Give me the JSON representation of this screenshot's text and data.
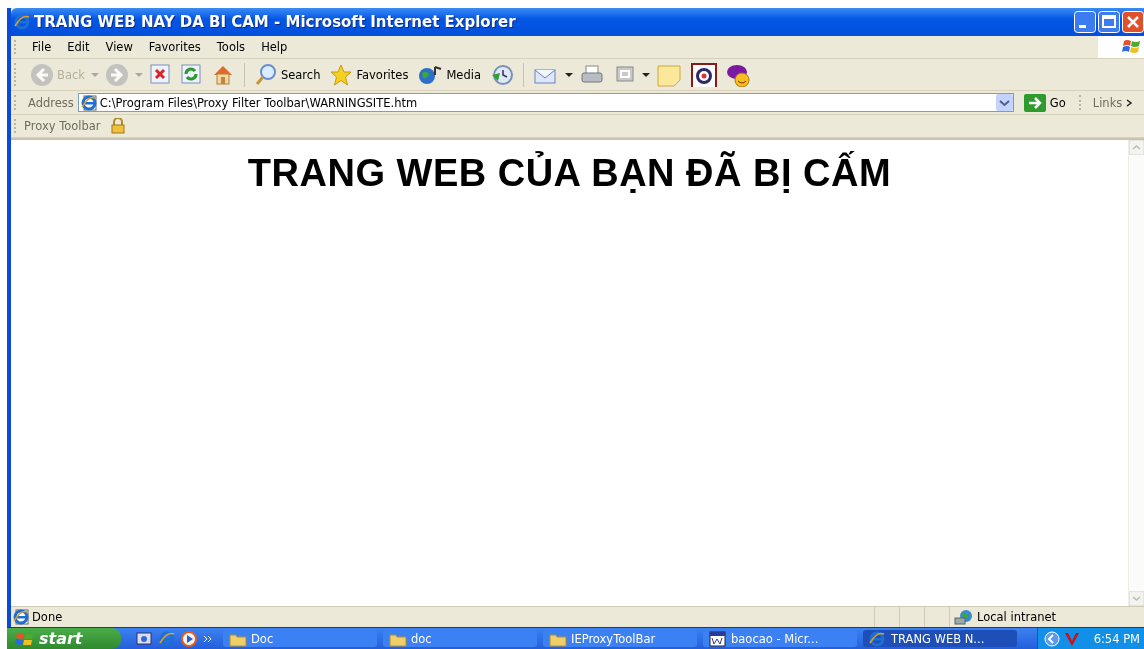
{
  "window": {
    "title": "TRANG WEB NAY DA BI CAM - Microsoft Internet Explorer"
  },
  "menu": [
    "File",
    "Edit",
    "View",
    "Favorites",
    "Tools",
    "Help"
  ],
  "toolbar": [
    {
      "kind": "back",
      "label": "Back",
      "disabled": true
    },
    {
      "kind": "caret",
      "disabled": true
    },
    {
      "kind": "forward",
      "disabled": true
    },
    {
      "kind": "caret",
      "disabled": true
    },
    {
      "kind": "stop",
      "disabled": false
    },
    {
      "kind": "refresh",
      "disabled": false
    },
    {
      "kind": "home",
      "disabled": false
    },
    {
      "kind": "separator"
    },
    {
      "kind": "search",
      "label": "Search",
      "disabled": false
    },
    {
      "kind": "favorites",
      "label": "Favorites",
      "disabled": false
    },
    {
      "kind": "media",
      "label": "Media",
      "disabled": false
    },
    {
      "kind": "history",
      "disabled": false
    },
    {
      "kind": "separator"
    },
    {
      "kind": "mail",
      "disabled": false
    },
    {
      "kind": "caret",
      "disabled": false
    },
    {
      "kind": "print",
      "disabled": false
    },
    {
      "kind": "edit",
      "disabled": false
    },
    {
      "kind": "caret",
      "disabled": false
    },
    {
      "kind": "note",
      "disabled": false
    },
    {
      "kind": "messenger",
      "disabled": false
    },
    {
      "kind": "yahoo",
      "disabled": false
    }
  ],
  "address_bar": {
    "label": "Address",
    "value": "C:\\Program Files\\Proxy Filter Toolbar\\WARNINGSITE.htm",
    "go": "Go",
    "links": "Links"
  },
  "proxy_toolbar": {
    "label": "Proxy Toolbar"
  },
  "page": {
    "heading": "TRANG WEB CỦA BẠN ĐÃ BỊ CẤM"
  },
  "status_bar": {
    "text": "Done",
    "zone": "Local intranet"
  },
  "taskbar": {
    "start": "start",
    "tasks": [
      {
        "kind": "folder",
        "label": "Doc",
        "selected": false
      },
      {
        "kind": "folder",
        "label": "doc",
        "selected": false
      },
      {
        "kind": "folder",
        "label": "IEProxyToolBar",
        "selected": false
      },
      {
        "kind": "word",
        "label": "baocao - Micr...",
        "selected": false
      },
      {
        "kind": "ie",
        "label": "TRANG WEB N...",
        "selected": true
      }
    ],
    "clock": "6:54 PM"
  }
}
